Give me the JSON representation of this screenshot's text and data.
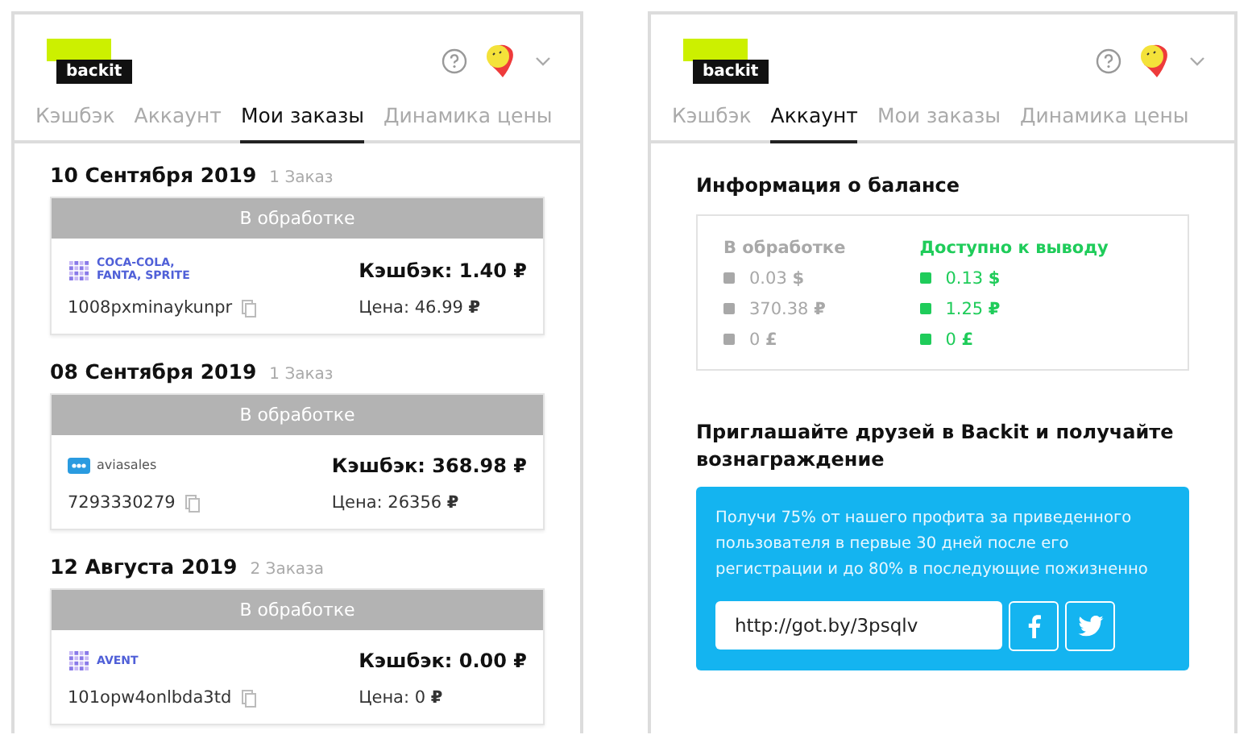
{
  "panels": [
    {
      "logo": "backit",
      "tabs": [
        {
          "label": "Кэшбэк",
          "selected": false
        },
        {
          "label": "Аккаунт",
          "selected": false
        },
        {
          "label": "Мои заказы",
          "selected": true
        },
        {
          "label": "Динамика цены",
          "selected": false
        }
      ],
      "kind": "orders",
      "order_groups": [
        {
          "date": "10 Сентября 2019",
          "count": "1 Заказ",
          "orders": [
            {
              "status": "В обработке",
              "merchant": "COCA-COLA, FANTA, SPRITE",
              "kind": "grid",
              "order_id": "1008pxminaykunpr",
              "cashback": "Кэшбэк: 1.40 ₽",
              "price": "Цена: 46.99 **₽**"
            }
          ]
        },
        {
          "date": "08 Сентября 2019",
          "count": "1 Заказ",
          "orders": [
            {
              "status": "В обработке",
              "merchant": "aviasales",
              "kind": "plane",
              "order_id": "7293330279",
              "cashback": "Кэшбэк: 368.98 ₽",
              "price": "Цена: 26356 **₽**"
            }
          ]
        },
        {
          "date": "12 Августа 2019",
          "count": "2 Заказа",
          "orders": [
            {
              "status": "В обработке",
              "merchant": "AVENT",
              "kind": "grid",
              "order_id": "101opw4onlbda3td",
              "cashback": "Кэшбэк: 0.00 ₽",
              "price": "Цена: 0 **₽**"
            }
          ]
        }
      ]
    },
    {
      "logo": "backit",
      "tabs": [
        {
          "label": "Кэшбэк",
          "selected": false
        },
        {
          "label": "Аккаунт",
          "selected": true
        },
        {
          "label": "Мои заказы",
          "selected": false
        },
        {
          "label": "Динамика цены",
          "selected": false
        }
      ],
      "kind": "account",
      "balance": {
        "title": "Информация о балансе",
        "columns": [
          {
            "heading": "В обработке",
            "color": "#a8a8a8",
            "amounts": [
              "0.03 **$**",
              "370.38 **₽**",
              "0 **£**"
            ]
          },
          {
            "heading": "Доступно к выводу",
            "color": "#1fcc5a",
            "amounts": [
              "0.13 **$**",
              "1.25 **₽**",
              "0 **£**"
            ]
          }
        ]
      },
      "invite": {
        "title": "Приглашайте друзей в Backit и получайте вознаграждение",
        "text": "Получи 75% от нашего профита за приведенного пользователя в первые 30 дней после его регистрации и до 80% в последующие пожизненно",
        "link": "http://got.by/3psqlv"
      }
    }
  ]
}
